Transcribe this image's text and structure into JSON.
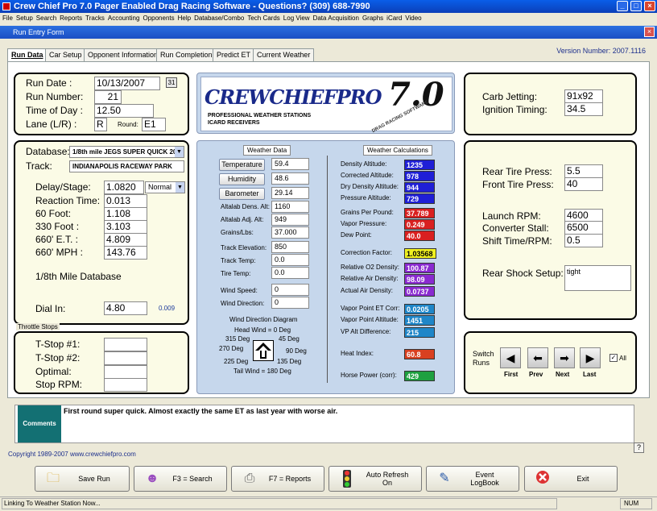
{
  "app": {
    "title": "Crew Chief Pro 7.0 Pager Enabled Drag Racing Software  -  Questions? (309) 688-7990"
  },
  "menu": [
    "File",
    "Setup",
    "Search",
    "Reports",
    "Tracks",
    "Accounting",
    "Opponents",
    "Help",
    "Database/Combo",
    "Tech Cards",
    "Log View",
    "Data Acquisition",
    "Graphs",
    "iCard",
    "Video"
  ],
  "form": {
    "title": "Run Entry Form",
    "version": "Version Number: 2007.1116"
  },
  "tabs": [
    "Run Data",
    "Car Setup",
    "Opponent Information",
    "Run Completion",
    "Predict ET",
    "Current Weather"
  ],
  "run": {
    "date_label": "Run Date :",
    "date": "10/13/2007",
    "cal_icon": "31",
    "number_label": "Run Number:",
    "number": "21",
    "time_label": "Time of Day :",
    "time": "12.50",
    "lane_label": "Lane (L/R) :",
    "lane": "R",
    "round_label": "Round:",
    "round": "E1"
  },
  "logo": {
    "text": "CREWCHIEFPRO",
    "version": "7.0",
    "tag": "DRAG RACING SOFTWARE",
    "line1": "PROFESSIONAL WEATHER STATIONS",
    "line2": "ICARD RECEIVERS"
  },
  "db": {
    "database_label": "Database:",
    "database": "1/8th mile JEGS SUPER QUICK 20",
    "track_label": "Track:",
    "track": "INDIANAPOLIS RACEWAY PARK",
    "delay_label": "Delay/Stage:",
    "delay": "1.0820",
    "stage_mode": "Normal",
    "reaction_label": "Reaction Time:",
    "reaction": "0.013",
    "ft60_label": "60 Foot:",
    "ft60": "1.108",
    "ft330_label": "330 Foot :",
    "ft330": "3.103",
    "et660_label": "660' E.T. :",
    "et660": "4.809",
    "mph660_label": "660' MPH :",
    "mph660": "143.76",
    "dbname": "1/8th Mile Database",
    "dial_label": "Dial In:",
    "dial": "4.80",
    "dial_diff": "0.009"
  },
  "throttle": {
    "group": "Throttle Stops",
    "t1": "T-Stop #1:",
    "t2": "T-Stop #2:",
    "optimal": "Optimal:",
    "rpm": "Stop RPM:"
  },
  "weather": {
    "header": "Weather Data",
    "temp_btn": "Temperature",
    "temp": "59.4",
    "hum_btn": "Humidity",
    "hum": "48.6",
    "baro_btn": "Barometer",
    "baro": "29.14",
    "dens_label": "Altalab Dens. Alt:",
    "dens": "1160",
    "adj_label": "Altalab Adj. Alt:",
    "adj": "949",
    "grains_label": "Grains/Lbs:",
    "grains": "37.000",
    "elev_label": "Track Elevation:",
    "elev": "850",
    "ttemp_label": "Track Temp:",
    "ttemp": "0.0",
    "tire_label": "Tire Temp:",
    "tire": "0.0",
    "wspeed_label": "Wind Speed:",
    "wspeed": "0",
    "wdir_label": "Wind Direction:",
    "wdir": "0",
    "diagram": "Wind Direction Diagram",
    "head": "Head Wind = 0 Deg",
    "d315": "315 Deg",
    "d45": "45 Deg",
    "d270": "270 Deg",
    "d90": "90 Deg",
    "d225": "225 Deg",
    "d135": "135 Deg",
    "tail": "Tail Wind = 180 Deg"
  },
  "calc": {
    "header": "Weather Calculations",
    "items": [
      {
        "label": "Density Altitude:",
        "value": "1235",
        "color": "#1f1fd6"
      },
      {
        "label": "Corrected Altitude:",
        "value": "978",
        "color": "#1f1fd6"
      },
      {
        "label": "Dry Density Altitude:",
        "value": "944",
        "color": "#1f1fd6"
      },
      {
        "label": "Pressure Altitude:",
        "value": "729",
        "color": "#1f1fd6"
      },
      {
        "label": "Grains Per Pound:",
        "value": "37.789",
        "color": "#d92020"
      },
      {
        "label": "Vapor Pressure:",
        "value": "0.249",
        "color": "#d92020"
      },
      {
        "label": "Dew Point:",
        "value": "40.0",
        "color": "#d92020"
      },
      {
        "label": "Correction Factor:",
        "value": "1.03568",
        "color": "#f0f020"
      },
      {
        "label": "Relative O2 Density:",
        "value": "100.87",
        "color": "#8a2ad0"
      },
      {
        "label": "Relative Air Density:",
        "value": "98.09",
        "color": "#8a2ad0"
      },
      {
        "label": "Actual Air Density:",
        "value": "0.0737",
        "color": "#8a2ad0"
      },
      {
        "label": "Vapor Point ET Corr:",
        "value": "0.0205",
        "color": "#1f86c8"
      },
      {
        "label": "Vapor Point Altitude:",
        "value": "1451",
        "color": "#1f86c8"
      },
      {
        "label": "VP Alt Difference:",
        "value": "215",
        "color": "#1f86c8"
      },
      {
        "label": "Heat Index:",
        "value": "60.8",
        "color": "#d94020"
      },
      {
        "label": "Horse Power (corr):",
        "value": "429",
        "color": "#1ea040"
      }
    ]
  },
  "carb": {
    "jet_label": "Carb Jetting:",
    "jet": "91x92",
    "ign_label": "Ignition Timing:",
    "ign": "34.5"
  },
  "setup": {
    "rtire_label": "Rear Tire Press:",
    "rtire": "5.5",
    "ftire_label": "Front Tire Press:",
    "ftire": "40",
    "launch_label": "Launch RPM:",
    "launch": "4600",
    "stall_label": "Converter Stall:",
    "stall": "6500",
    "shift_label": "Shift Time/RPM:",
    "shift": "0.5",
    "shock_label": "Rear Shock Setup:",
    "shock": "tight"
  },
  "nav": {
    "switch": "Switch",
    "runs": "Runs",
    "first": "First",
    "prev": "Prev",
    "next": "Next",
    "last": "Last",
    "all": "All"
  },
  "comments": {
    "label": "Comments",
    "text": "First round super quick.  Almost exactly the same ET as last year with worse air."
  },
  "footer": {
    "copyright": "Copyright 1989-2007  www.crewchiefpro.com",
    "help": "?"
  },
  "buttons": [
    {
      "label": "Save Run",
      "icon": "folder-icon"
    },
    {
      "label": "F3 = Search",
      "icon": "people-icon"
    },
    {
      "label": "F7 = Reports",
      "icon": "printer-icon"
    },
    {
      "label": "Auto Refresh On",
      "icon": "traffic-light-icon"
    },
    {
      "label": "Event LogBook",
      "icon": "notepad-icon"
    },
    {
      "label": "Exit",
      "icon": "exit-icon"
    }
  ],
  "status": {
    "text": "Linking To Weather Station Now...",
    "num": "NUM"
  }
}
